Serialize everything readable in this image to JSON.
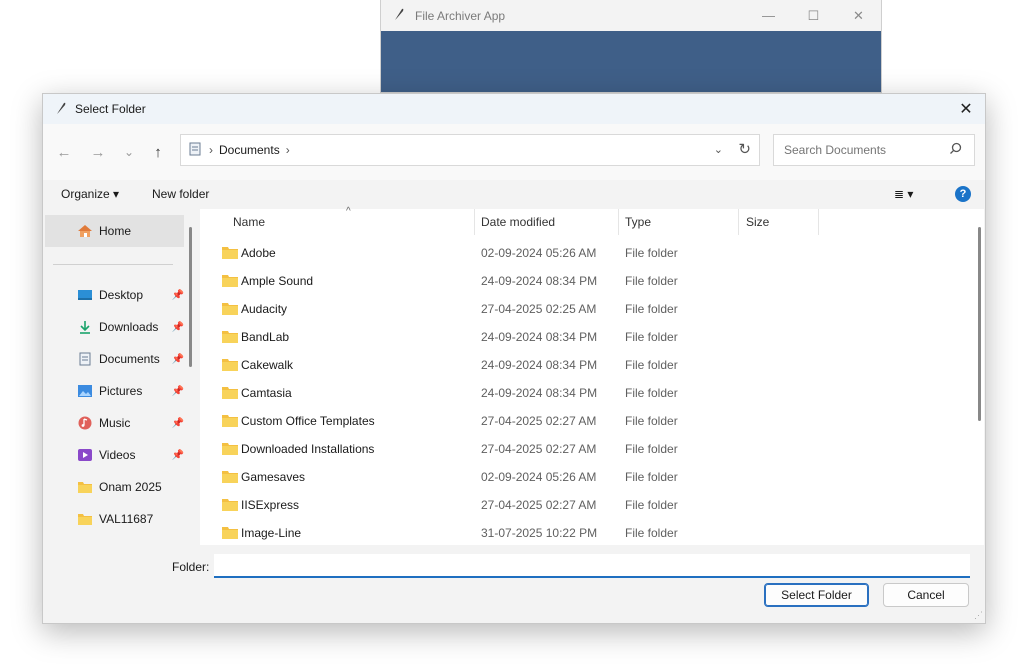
{
  "background_window": {
    "title": "File Archiver App",
    "controls": [
      "—",
      "☐",
      "✕"
    ],
    "body_color": "#3f5f88"
  },
  "dialog": {
    "title": "Select Folder",
    "close": "✕"
  },
  "nav": {
    "back": "←",
    "forward": "→",
    "recent": "⌄",
    "up": "↑",
    "breadcrumb": [
      "Documents"
    ],
    "separator": "›",
    "dropdown": "⌄",
    "refresh": "↻",
    "search_placeholder": "Search Documents"
  },
  "toolbar": {
    "organize": "Organize ▾",
    "new_folder": "New folder",
    "view": "≣ ▾",
    "help": "?"
  },
  "sidebar": {
    "home": "Home",
    "items": [
      {
        "label": "Desktop",
        "icon": "desktop-icon",
        "pinned": true
      },
      {
        "label": "Downloads",
        "icon": "download-icon",
        "pinned": true
      },
      {
        "label": "Documents",
        "icon": "document-icon",
        "pinned": true
      },
      {
        "label": "Pictures",
        "icon": "picture-icon",
        "pinned": true
      },
      {
        "label": "Music",
        "icon": "music-icon",
        "pinned": true
      },
      {
        "label": "Videos",
        "icon": "video-icon",
        "pinned": true
      },
      {
        "label": "Onam 2025",
        "icon": "folder-icon",
        "pinned": false
      },
      {
        "label": "VAL11687",
        "icon": "folder-icon",
        "pinned": false
      }
    ]
  },
  "columns": {
    "name": "Name",
    "date": "Date modified",
    "type": "Type",
    "size": "Size",
    "sort_indicator": "^"
  },
  "files": [
    {
      "name": "Adobe",
      "date": "02-09-2024 05:26 AM",
      "type": "File folder"
    },
    {
      "name": "Ample Sound",
      "date": "24-09-2024 08:34 PM",
      "type": "File folder"
    },
    {
      "name": "Audacity",
      "date": "27-04-2025 02:25 AM",
      "type": "File folder"
    },
    {
      "name": "BandLab",
      "date": "24-09-2024 08:34 PM",
      "type": "File folder"
    },
    {
      "name": "Cakewalk",
      "date": "24-09-2024 08:34 PM",
      "type": "File folder"
    },
    {
      "name": "Camtasia",
      "date": "24-09-2024 08:34 PM",
      "type": "File folder"
    },
    {
      "name": "Custom Office Templates",
      "date": "27-04-2025 02:27 AM",
      "type": "File folder"
    },
    {
      "name": "Downloaded Installations",
      "date": "27-04-2025 02:27 AM",
      "type": "File folder"
    },
    {
      "name": "Gamesaves",
      "date": "02-09-2024 05:26 AM",
      "type": "File folder"
    },
    {
      "name": "IISExpress",
      "date": "27-04-2025 02:27 AM",
      "type": "File folder"
    },
    {
      "name": "Image-Line",
      "date": "31-07-2025 10:22 PM",
      "type": "File folder"
    }
  ],
  "footer": {
    "folder_label": "Folder:",
    "folder_value": "",
    "select_button": "Select Folder",
    "cancel_button": "Cancel"
  },
  "colors": {
    "accent": "#1f6fc0",
    "folder": "#f4c042",
    "home_selected": "#e2e2e2"
  }
}
